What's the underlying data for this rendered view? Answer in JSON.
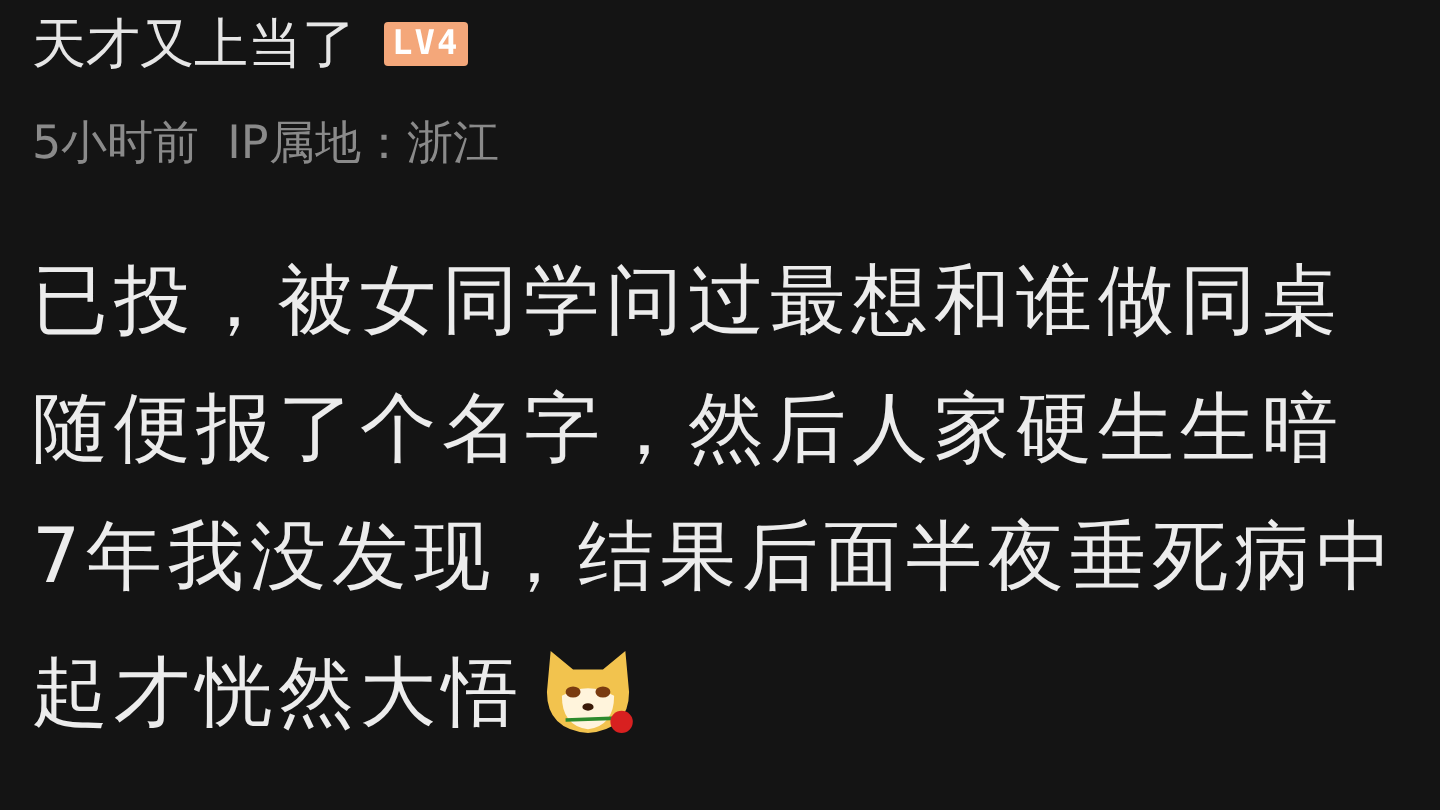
{
  "comment": {
    "username": "天才又上当了",
    "level_badge": "LV4",
    "time": "5小时前",
    "ip_location": "IP属地：浙江",
    "lines": [
      "已投，被女同学问过最想和谁做同桌",
      "随便报了个名字，然后人家硬生生暗",
      "7年我没发现，结果后面半夜垂死病中",
      "起才恍然大悟"
    ]
  }
}
